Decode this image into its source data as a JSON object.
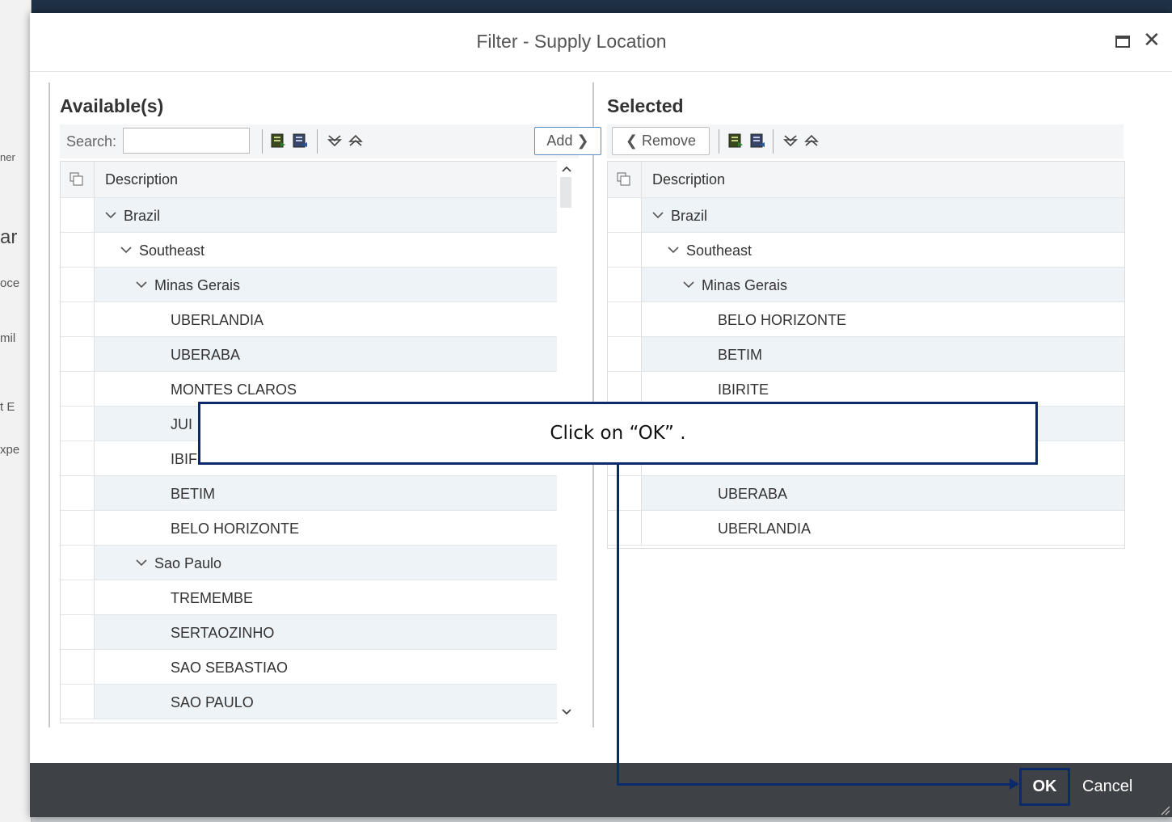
{
  "dialog": {
    "title": "Filter - Supply Location",
    "ok_label": "OK",
    "cancel_label": "Cancel"
  },
  "background": {
    "fragments": [
      "ner",
      "ar",
      "oce",
      "mil",
      "t E",
      "xpe"
    ]
  },
  "available": {
    "title": "Available(s)",
    "search_label": "Search:",
    "search_value": "",
    "add_label": "Add",
    "column_header": "Description",
    "rows": [
      {
        "label": "Brazil",
        "level": 0,
        "expandable": true
      },
      {
        "label": "Southeast",
        "level": 1,
        "expandable": true
      },
      {
        "label": "Minas Gerais",
        "level": 2,
        "expandable": true
      },
      {
        "label": "UBERLANDIA",
        "level": 3,
        "expandable": false
      },
      {
        "label": "UBERABA",
        "level": 3,
        "expandable": false
      },
      {
        "label": "MONTES CLAROS",
        "level": 3,
        "expandable": false
      },
      {
        "label": "JUI",
        "level": 3,
        "expandable": false
      },
      {
        "label": "IBIF",
        "level": 3,
        "expandable": false
      },
      {
        "label": "BETIM",
        "level": 3,
        "expandable": false
      },
      {
        "label": "BELO HORIZONTE",
        "level": 3,
        "expandable": false
      },
      {
        "label": "Sao Paulo",
        "level": 2,
        "expandable": true
      },
      {
        "label": "TREMEMBE",
        "level": 3,
        "expandable": false
      },
      {
        "label": "SERTAOZINHO",
        "level": 3,
        "expandable": false
      },
      {
        "label": "SAO SEBASTIAO",
        "level": 3,
        "expandable": false
      },
      {
        "label": "SAO PAULO",
        "level": 3,
        "expandable": false
      }
    ]
  },
  "selected": {
    "title": "Selected",
    "remove_label": "Remove",
    "column_header": "Description",
    "rows": [
      {
        "label": "Brazil",
        "level": 0,
        "expandable": true
      },
      {
        "label": "Southeast",
        "level": 1,
        "expandable": true
      },
      {
        "label": "Minas Gerais",
        "level": 2,
        "expandable": true
      },
      {
        "label": "BELO HORIZONTE",
        "level": 3,
        "expandable": false
      },
      {
        "label": "BETIM",
        "level": 3,
        "expandable": false
      },
      {
        "label": "IBIRITE",
        "level": 3,
        "expandable": false
      },
      {
        "label": "",
        "level": 3,
        "expandable": false
      },
      {
        "label": "",
        "level": 3,
        "expandable": false
      },
      {
        "label": "UBERABA",
        "level": 3,
        "expandable": false
      },
      {
        "label": "UBERLANDIA",
        "level": 3,
        "expandable": false
      }
    ]
  },
  "callout": {
    "text": "Click on “OK” ."
  },
  "colors": {
    "callout_border": "#0a2a6b",
    "footer": "#3e4247",
    "row_alt": "#eef3f8"
  },
  "icons": [
    "maximize-icon",
    "close-icon",
    "export-icon",
    "import-icon",
    "expand-all-icon",
    "collapse-all-icon",
    "chevron-down-icon",
    "chevron-right-icon",
    "chevron-left-icon",
    "copy-icon"
  ]
}
